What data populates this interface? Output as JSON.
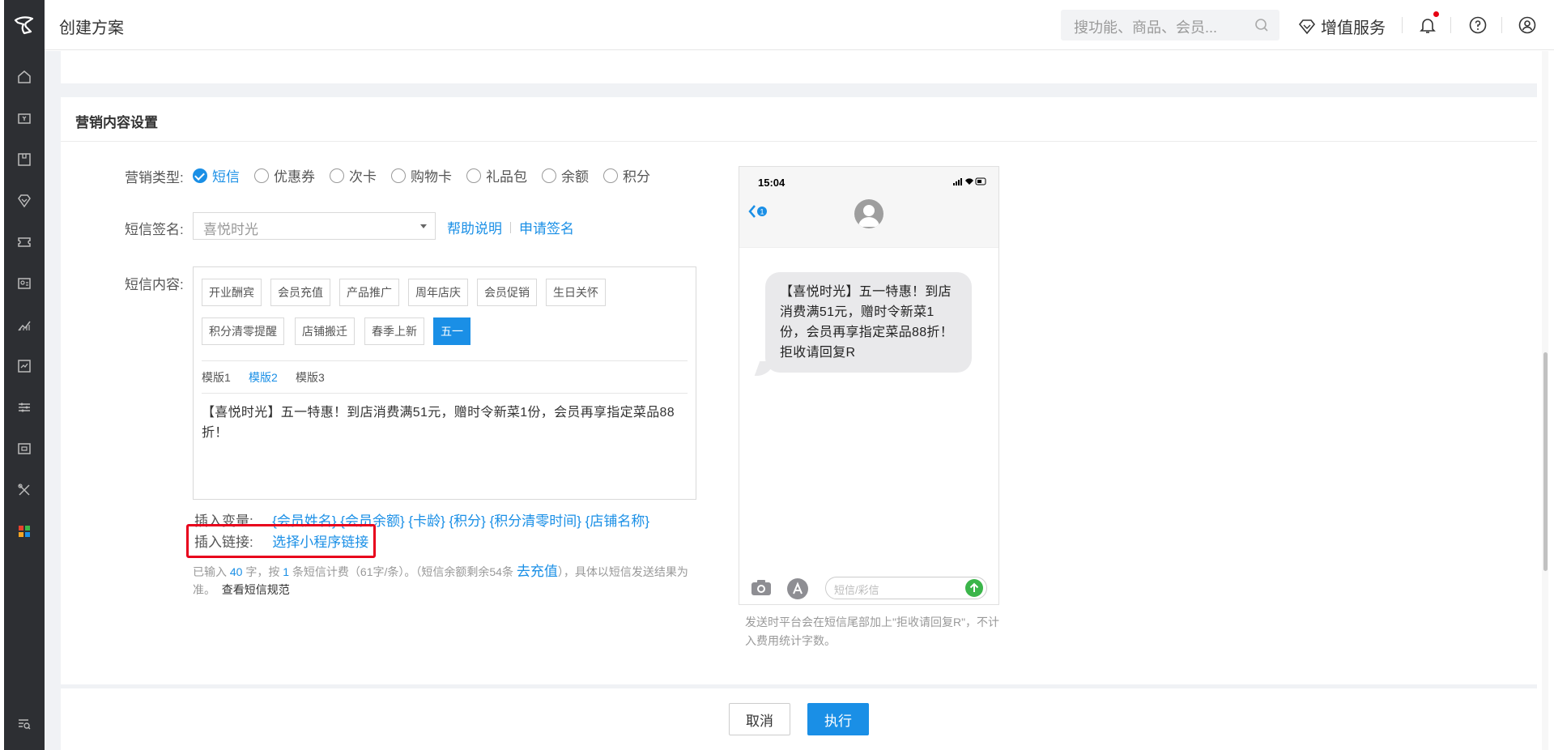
{
  "header": {
    "title": "创建方案",
    "search_placeholder": "搜功能、商品、会员...",
    "vas_label": "增值服务"
  },
  "sidebar": {
    "items": [
      "home-icon",
      "cashier-icon",
      "goods-icon",
      "vip-icon",
      "coupon-icon",
      "member-card-icon",
      "stats-icon",
      "report-icon",
      "settings-icon",
      "device-icon",
      "tools-icon",
      "apps-icon",
      "search-list-icon"
    ]
  },
  "section": {
    "title": "营销内容设置"
  },
  "form": {
    "type_label": "营销类型:",
    "types": [
      {
        "label": "短信",
        "checked": true
      },
      {
        "label": "优惠券",
        "checked": false
      },
      {
        "label": "次卡",
        "checked": false
      },
      {
        "label": "购物卡",
        "checked": false
      },
      {
        "label": "礼品包",
        "checked": false
      },
      {
        "label": "余额",
        "checked": false
      },
      {
        "label": "积分",
        "checked": false
      }
    ],
    "signature_label": "短信签名:",
    "signature_value": "喜悦时光",
    "help_link": "帮助说明",
    "apply_link": "申请签名",
    "content_label": "短信内容:",
    "tags_row1": [
      "开业酬宾",
      "会员充值",
      "产品推广",
      "周年店庆",
      "会员促销",
      "生日关怀"
    ],
    "tags_row2": [
      "积分清零提醒",
      "店铺搬迁",
      "春季上新",
      "五一"
    ],
    "active_tag": "五一",
    "templates": [
      "模版1",
      "模版2",
      "模版3"
    ],
    "active_template": "模版2",
    "sms_text": "【喜悦时光】五一特惠！到店消费满51元，赠时令新菜1份，会员再享指定菜品88折！",
    "insert_var_label": "插入变量:",
    "vars": [
      "{会员姓名}",
      "{会员余额}",
      "{卡龄}",
      "{积分}",
      "{积分清零时间}",
      "{店铺名称}"
    ],
    "insert_link_label": "插入链接:",
    "insert_link_action": "选择小程序链接",
    "note": {
      "p1": "已输入",
      "count": "40",
      "p2": "字，按",
      "msgs": "1",
      "p3": "条短信计费（61字/条）。（短信余额剩余54条",
      "recharge": "去充值",
      "p4": "），具体以短信发送结果为准。",
      "rules": "查看短信规范"
    }
  },
  "phone": {
    "time": "15:04",
    "badge": "1",
    "bubble": "【喜悦时光】五一特惠！到店消费满51元，赠时令新菜1份，会员再享指定菜品88折！ 拒收请回复R",
    "input_placeholder": "短信/彩信",
    "note": "发送时平台会在短信尾部加上\"拒收请回复R\"，不计入费用统计字数。"
  },
  "footer": {
    "cancel": "取消",
    "execute": "执行"
  }
}
